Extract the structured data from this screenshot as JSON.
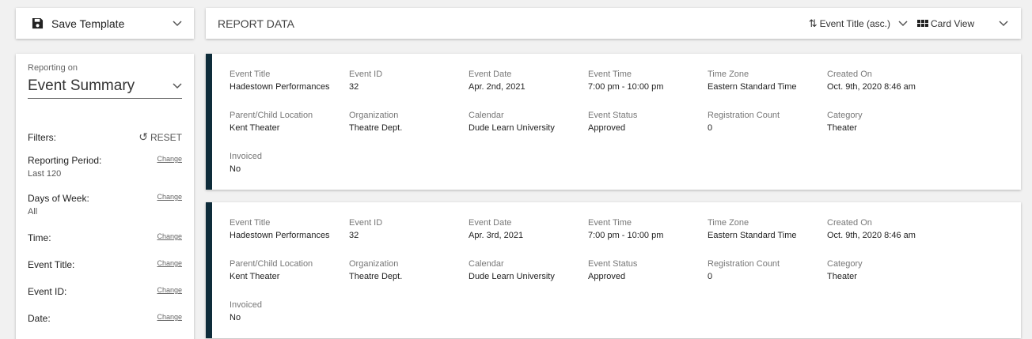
{
  "save_template": {
    "label": "Save Template",
    "icon": "floppy-disk-icon"
  },
  "header": {
    "title": "REPORT DATA",
    "sort_label": "Event Title (asc.)",
    "view_label": "Card View"
  },
  "sidebar": {
    "reporting_on_label": "Reporting on",
    "reporting_on_value": "Event Summary",
    "filters_label": "Filters:",
    "reset_label": "RESET",
    "filters": [
      {
        "name": "Reporting Period:",
        "value": "Last 120",
        "change": "Change"
      },
      {
        "name": "Days of Week:",
        "value": "All",
        "change": "Change"
      },
      {
        "name": "Time:",
        "change": "Change"
      },
      {
        "name": "Event Title:",
        "change": "Change"
      },
      {
        "name": "Event ID:",
        "change": "Change"
      },
      {
        "name": "Date:",
        "change": "Change"
      }
    ]
  },
  "events": [
    {
      "rows": [
        [
          {
            "label": "Event Title",
            "value": "Hadestown Performances"
          },
          {
            "label": "Event ID",
            "value": "32"
          },
          {
            "label": "Event Date",
            "value": "Apr. 2nd, 2021"
          },
          {
            "label": "Event Time",
            "value": "7:00 pm - 10:00 pm"
          },
          {
            "label": "Time Zone",
            "value": "Eastern Standard Time"
          },
          {
            "label": "Created On",
            "value": "Oct. 9th, 2020 8:46 am"
          }
        ],
        [
          {
            "label": "Parent/Child Location",
            "value": "Kent Theater"
          },
          {
            "label": "Organization",
            "value": "Theatre Dept."
          },
          {
            "label": "Calendar",
            "value": "Dude Learn University"
          },
          {
            "label": "Event Status",
            "value": "Approved"
          },
          {
            "label": "Registration Count",
            "value": "0"
          },
          {
            "label": "Category",
            "value": "Theater"
          }
        ],
        [
          {
            "label": "Invoiced",
            "value": "No"
          }
        ]
      ]
    },
    {
      "rows": [
        [
          {
            "label": "Event Title",
            "value": "Hadestown Performances"
          },
          {
            "label": "Event ID",
            "value": "32"
          },
          {
            "label": "Event Date",
            "value": "Apr. 3rd, 2021"
          },
          {
            "label": "Event Time",
            "value": "7:00 pm - 10:00 pm"
          },
          {
            "label": "Time Zone",
            "value": "Eastern Standard Time"
          },
          {
            "label": "Created On",
            "value": "Oct. 9th, 2020 8:46 am"
          }
        ],
        [
          {
            "label": "Parent/Child Location",
            "value": "Kent Theater"
          },
          {
            "label": "Organization",
            "value": "Theatre Dept."
          },
          {
            "label": "Calendar",
            "value": "Dude Learn University"
          },
          {
            "label": "Event Status",
            "value": "Approved"
          },
          {
            "label": "Registration Count",
            "value": "0"
          },
          {
            "label": "Category",
            "value": "Theater"
          }
        ],
        [
          {
            "label": "Invoiced",
            "value": "No"
          }
        ]
      ]
    }
  ]
}
